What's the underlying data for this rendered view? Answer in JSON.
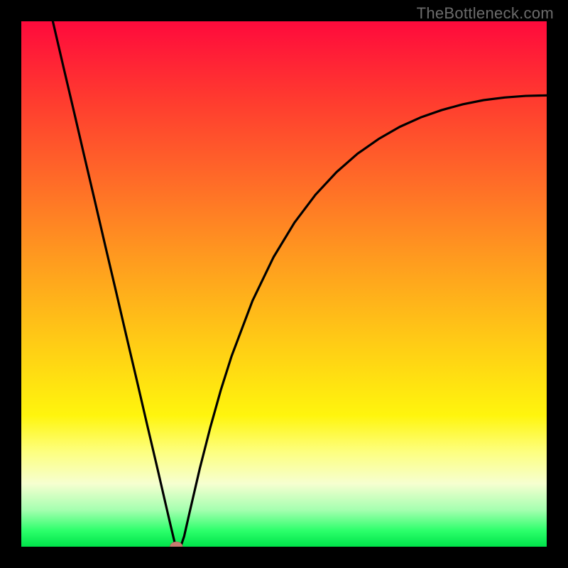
{
  "watermark": "TheBottleneck.com",
  "chart_data": {
    "type": "line",
    "title": "",
    "xlabel": "",
    "ylabel": "",
    "xlim": [
      0,
      100
    ],
    "ylim": [
      0,
      100
    ],
    "grid": false,
    "annotations": [
      {
        "type": "marker",
        "x": 29.5,
        "y": 0.0,
        "color": "#c77b70",
        "shape": "ellipse"
      }
    ],
    "series": [
      {
        "name": "curve",
        "color": "#000000",
        "x": [
          6.0,
          8.0,
          10.0,
          12.0,
          14.0,
          16.0,
          18.0,
          20.0,
          22.0,
          24.0,
          26.0,
          27.5,
          28.5,
          29.0,
          29.5,
          30.3,
          31.0,
          32.0,
          34.0,
          36.0,
          38.0,
          40.0,
          44.0,
          48.0,
          52.0,
          56.0,
          60.0,
          64.0,
          68.0,
          72.0,
          76.0,
          80.0,
          84.0,
          88.0,
          92.0,
          96.0,
          100.0
        ],
        "y": [
          100.0,
          91.4,
          82.9,
          74.3,
          65.8,
          57.2,
          48.7,
          40.1,
          31.6,
          23.0,
          14.5,
          8.0,
          3.7,
          1.6,
          -0.5,
          -0.1,
          2.0,
          6.4,
          15.0,
          22.8,
          29.9,
          36.2,
          46.8,
          55.1,
          61.7,
          67.0,
          71.3,
          74.8,
          77.6,
          79.9,
          81.7,
          83.1,
          84.2,
          85.0,
          85.5,
          85.8,
          85.9
        ]
      }
    ]
  }
}
